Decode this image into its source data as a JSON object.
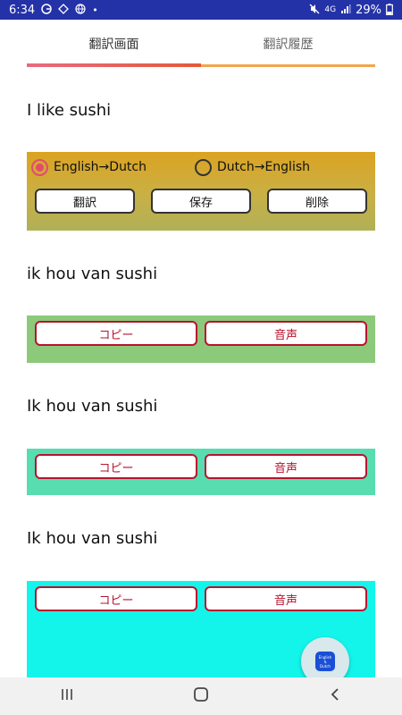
{
  "status_bar": {
    "time": "6:34",
    "battery": "29%",
    "network": "4G"
  },
  "tabs": [
    {
      "label": "翻訳画面",
      "active": true
    },
    {
      "label": "翻訳履歴",
      "active": false
    }
  ],
  "input_text": "I like sushi",
  "translate_panel": {
    "radio_options": [
      {
        "label": "English→Dutch",
        "checked": true
      },
      {
        "label": "Dutch→English",
        "checked": false
      }
    ],
    "buttons": {
      "translate": "翻訳",
      "save": "保存",
      "delete": "削除"
    }
  },
  "results": [
    {
      "text": "ik hou van sushi",
      "copy_label": "コピー",
      "audio_label": "音声"
    },
    {
      "text": "Ik hou van sushi",
      "copy_label": "コピー",
      "audio_label": "音声"
    },
    {
      "text": "Ik hou van sushi",
      "copy_label": "コピー",
      "audio_label": "音声"
    }
  ],
  "fab": {
    "line1": "English",
    "line2": "⇅",
    "line3": "Dutch"
  },
  "colors": {
    "status_bar": "#2432a8",
    "active_tab_indicator": "#e35a3a",
    "translate_panel": "#dba322",
    "result_panel_1": "#8cc97a",
    "result_panel_2": "#58ddb1",
    "result_panel_3": "#13f5ea",
    "result_button_border": "#b9122e",
    "radio_checked": "#e24b6e"
  },
  "icons": {
    "status_left": [
      "google-icon",
      "navigation-icon",
      "globe-icon",
      "dot-icon"
    ],
    "status_right": [
      "mute-icon",
      "network-icon",
      "signal-icon",
      "battery-icon"
    ],
    "nav_bar": [
      "recent-apps-icon",
      "home-icon",
      "back-icon"
    ],
    "fab": "language-swap-icon"
  }
}
